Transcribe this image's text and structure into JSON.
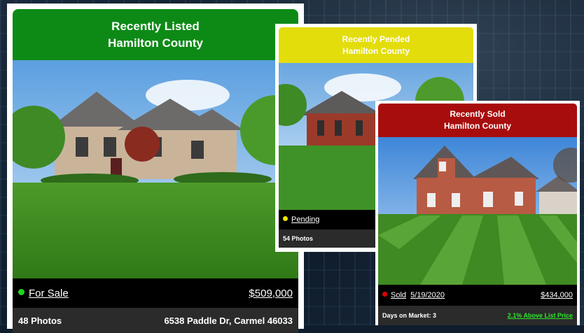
{
  "cards": {
    "listed": {
      "title_line1": "Recently Listed",
      "title_line2": "Hamilton County",
      "status": "For Sale",
      "price": "$509,000",
      "photos": "48 Photos",
      "address": "6538 Paddle Dr, Carmel 46033",
      "header_color": "#0d8a16",
      "dot_color": "#1fd51f"
    },
    "pended": {
      "title_line1": "Recently Pended",
      "title_line2": "Hamilton County",
      "status": "Pending",
      "photos": "54 Photos",
      "header_color": "#e3dd0c",
      "dot_color": "#f2e400"
    },
    "sold": {
      "title_line1": "Recently Sold",
      "title_line2": "Hamilton County",
      "status": "Sold",
      "sold_date": "5/19/2020",
      "price": "$434,000",
      "days_on_market": "Days on Market: 3",
      "above_list": "2.1% Above List Price",
      "header_color": "#a80d0d",
      "dot_color": "#e60000",
      "above_list_color": "#2ee62e"
    }
  }
}
